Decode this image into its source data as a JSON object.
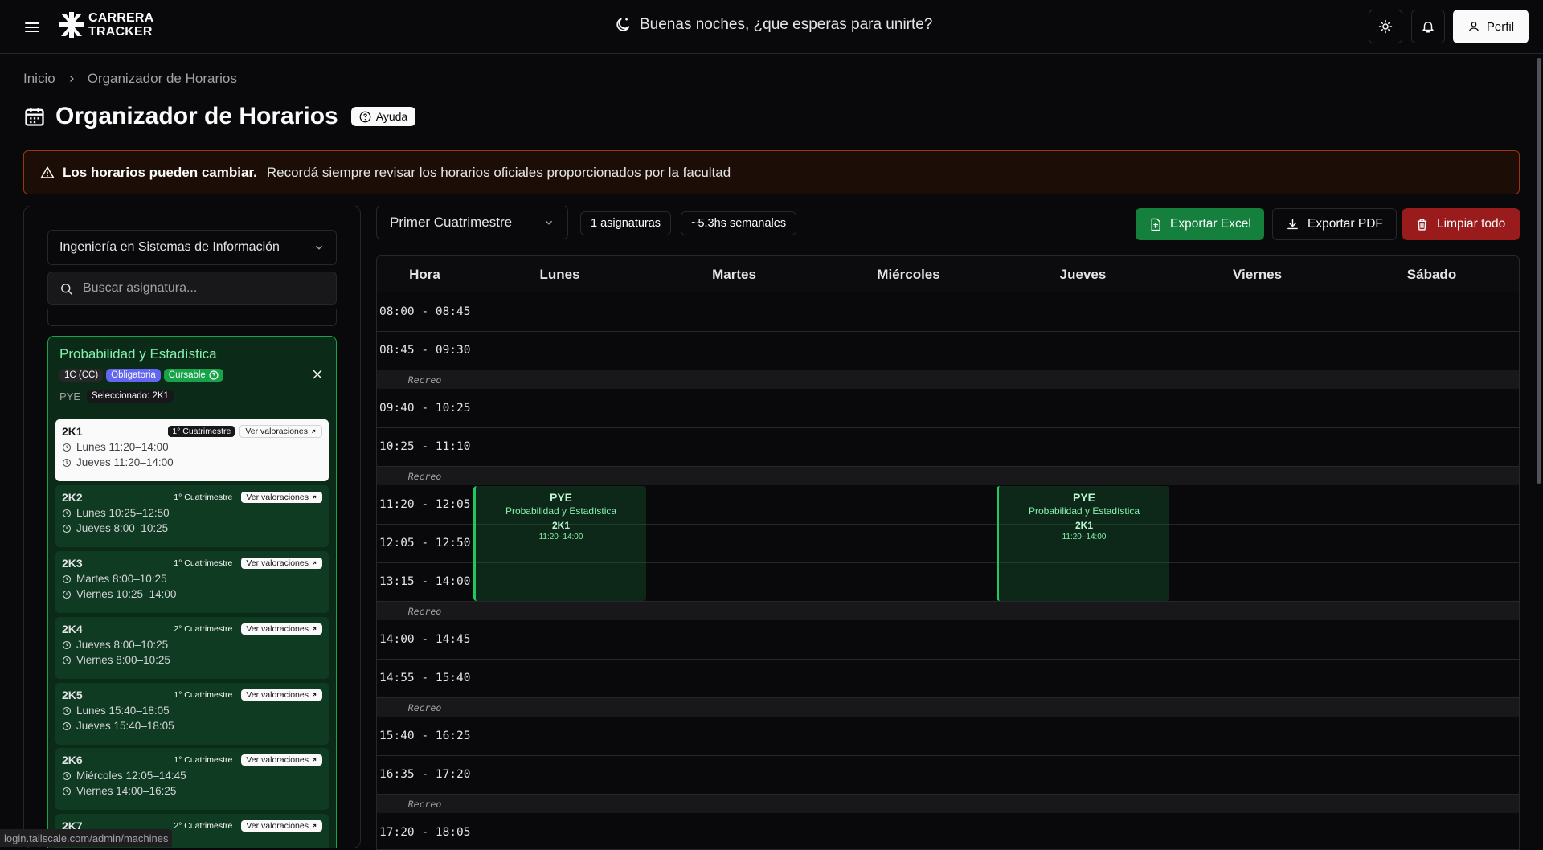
{
  "header": {
    "logo_line1": "CARRERA",
    "logo_line2": "TRACKER",
    "greeting": "Buenas noches, ¿que esperas para unirte?",
    "profile_label": "Perfil"
  },
  "breadcrumb": {
    "home": "Inicio",
    "current": "Organizador de Horarios"
  },
  "page": {
    "title": "Organizador de Horarios",
    "help_label": "Ayuda"
  },
  "alert": {
    "title": "Los horarios pueden cambiar.",
    "message": "Recordá siempre revisar los horarios oficiales proporcionados por la facultad"
  },
  "sidebar": {
    "career": "Ingeniería en Sistemas de Información",
    "search_placeholder": "Buscar asignatura...",
    "subject": {
      "title": "Probabilidad y Estadística",
      "badge_cc": "1C (CC)",
      "badge_obligatoria": "Obligatoria",
      "badge_cursable": "Cursable",
      "code": "PYE",
      "selected": "Seleccionado: 2K1",
      "commissions": [
        {
          "name": "2K1",
          "cuat": "1° Cuatrimestre",
          "val": "Ver valoraciones",
          "slot1": "Lunes 11:20–14:00",
          "slot2": "Jueves 11:20–14:00"
        },
        {
          "name": "2K2",
          "cuat": "1° Cuatrimestre",
          "val": "Ver valoraciones",
          "slot1": "Lunes 10:25–12:50",
          "slot2": "Jueves 8:00–10:25"
        },
        {
          "name": "2K3",
          "cuat": "1° Cuatrimestre",
          "val": "Ver valoraciones",
          "slot1": "Martes 8:00–10:25",
          "slot2": "Viernes 10:25–14:00"
        },
        {
          "name": "2K4",
          "cuat": "2° Cuatrimestre",
          "val": "Ver valoraciones",
          "slot1": "Jueves 8:00–10:25",
          "slot2": "Viernes 8:00–10:25"
        },
        {
          "name": "2K5",
          "cuat": "1° Cuatrimestre",
          "val": "Ver valoraciones",
          "slot1": "Lunes 15:40–18:05",
          "slot2": "Jueves 15:40–18:05"
        },
        {
          "name": "2K6",
          "cuat": "1° Cuatrimestre",
          "val": "Ver valoraciones",
          "slot1": "Miércoles 12:05–14:45",
          "slot2": "Viernes 14:00–16:25"
        },
        {
          "name": "2K7",
          "cuat": "2° Cuatrimestre",
          "val": "Ver valoraciones",
          "slot1": "",
          "slot2": ""
        }
      ]
    }
  },
  "toolbar": {
    "period": "Primer Cuatrimestre",
    "subjects_count": "1 asignaturas",
    "weekly_hours": "~5.3hs semanales",
    "export_excel": "Exportar Excel",
    "export_pdf": "Exportar PDF",
    "clear_all": "Limpiar todo"
  },
  "schedule": {
    "headers": [
      "Hora",
      "Lunes",
      "Martes",
      "Miércoles",
      "Jueves",
      "Viernes",
      "Sábado"
    ],
    "recreo_label": "Recreo",
    "rows": [
      "08:00 - 08:45",
      "08:45 - 09:30",
      "09:40 - 10:25",
      "10:25 - 11:10",
      "11:20 - 12:05",
      "12:05 - 12:50",
      "13:15 - 14:00",
      "14:00 - 14:45",
      "14:55 - 15:40",
      "15:40 - 16:25",
      "16:35 - 17:20",
      "17:20 - 18:05"
    ],
    "event": {
      "code": "PYE",
      "name": "Probabilidad y Estadística",
      "commission": "2K1",
      "time": "11:20–14:00"
    }
  },
  "status_url": "login.tailscale.com/admin/machines"
}
